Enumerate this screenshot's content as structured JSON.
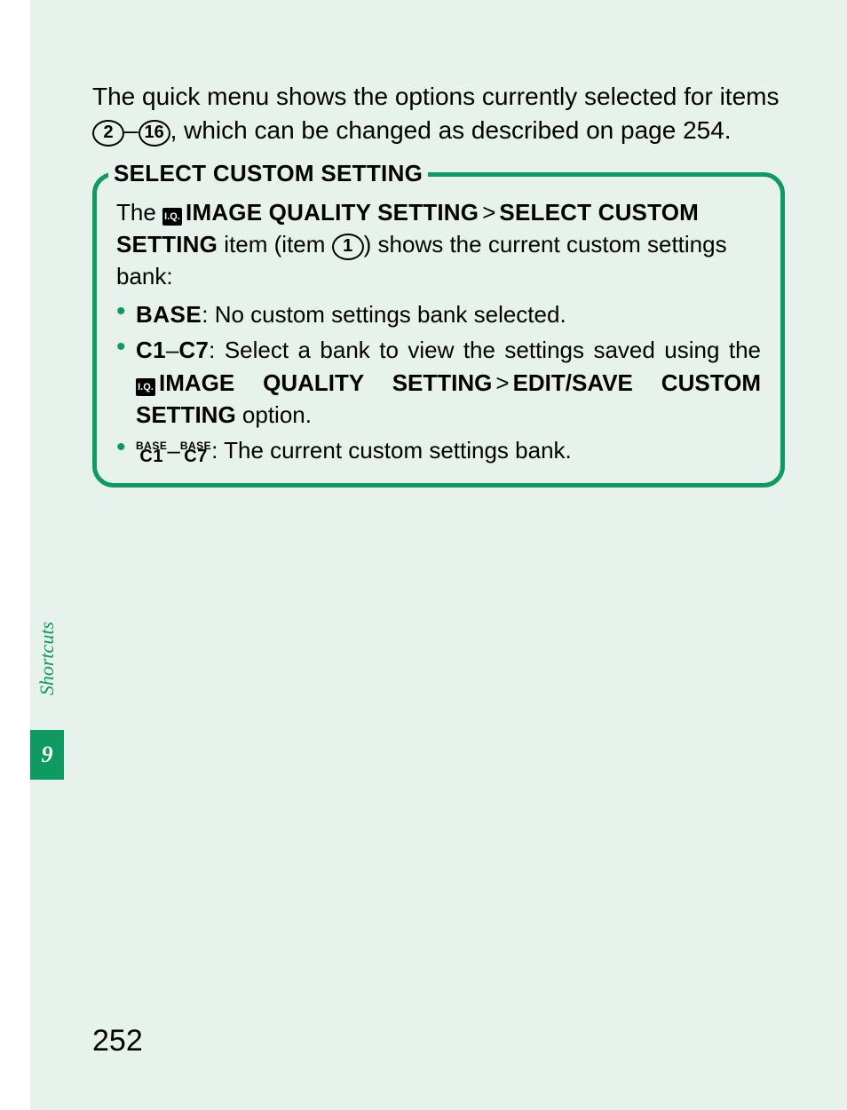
{
  "intro": {
    "part1": "The quick menu shows the options currently selected for items ",
    "circle_from": "2",
    "dash": "–",
    "circle_to": "16",
    "part2": ", which can be changed as described on page 254."
  },
  "box": {
    "title": "SELECT CUSTOM SETTING",
    "line1_pre": "The ",
    "iq_icon": "I.Q.",
    "menu1": "IMAGE QUALITY SETTING",
    "gt": ">",
    "menu2": "SELECT CUSTOM SETTING",
    "line1_mid": " item (item ",
    "circle_item": "1",
    "line1_post": ") shows the current custom settings bank:",
    "bullets": [
      {
        "lead_label": "BASE",
        "rest": ": No custom settings bank selected."
      },
      {
        "c_from": "C1",
        "dash": "–",
        "c_to": "C7",
        "rest1": ": Select a bank to view the settings saved using the ",
        "menu1": "IMAGE QUALITY SETTING",
        "gt": ">",
        "menu2": "EDIT/SAVE CUSTOM SETTING",
        "rest2": " option."
      },
      {
        "bc_from_top": "BASE",
        "bc_from_bot": "C1",
        "dash": "–",
        "bc_to_top": "BASE",
        "bc_to_bot": "C7",
        "rest": ": The current custom settings bank."
      }
    ]
  },
  "side": {
    "label": "Shortcuts",
    "chapter": "9"
  },
  "page_number": "252"
}
